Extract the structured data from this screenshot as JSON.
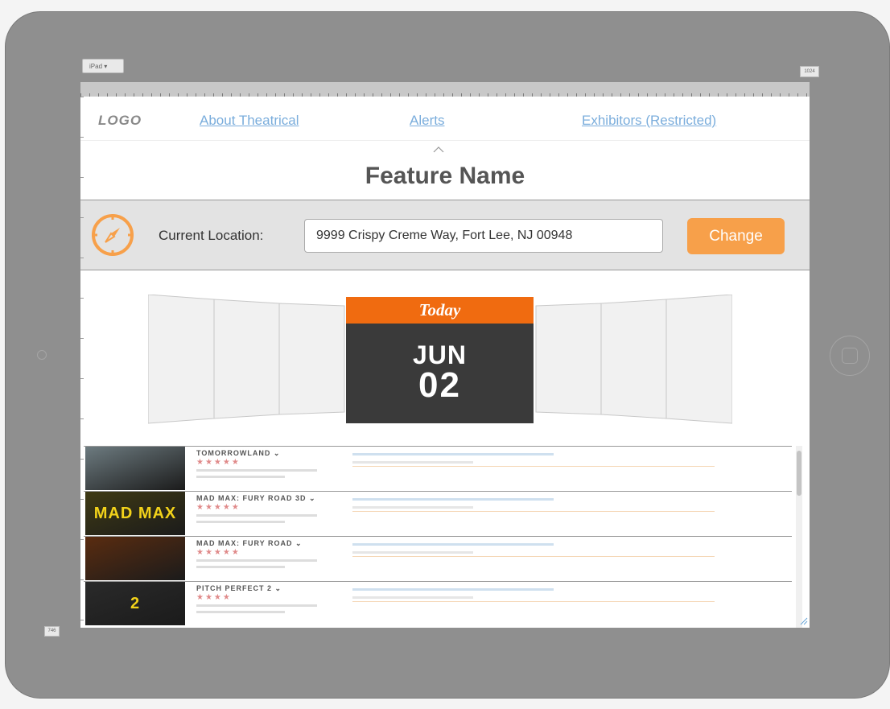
{
  "device": {
    "model_select": "iPad ▾",
    "width_tag": "1024",
    "height_tag": "746"
  },
  "nav": {
    "logo": "LOGO",
    "links": [
      "About Theatrical",
      "Alerts",
      "Exhibitors (Restricted)"
    ]
  },
  "feature": {
    "title": "Feature Name"
  },
  "location": {
    "label": "Current Location:",
    "value": "9999 Crispy Creme Way, Fort Lee, NJ 00948",
    "button": "Change"
  },
  "date_carousel": {
    "today_label": "Today",
    "month": "JUN",
    "day": "02"
  },
  "movies": [
    {
      "title": "TOMORROWLAND ⌄",
      "stars": "★★★★★",
      "poster_color": "#6d7b80"
    },
    {
      "title": "MAD MAX: FURY ROAD 3D ⌄",
      "stars": "★★★★★",
      "poster_color": "#3f3a14",
      "poster_text": "MAD MAX"
    },
    {
      "title": "MAD MAX: FURY ROAD ⌄",
      "stars": "★★★★★",
      "poster_color": "#5a2c10"
    },
    {
      "title": "PITCH PERFECT 2 ⌄",
      "stars": "★★★★",
      "poster_color": "#2a2a2a",
      "poster_text": "2"
    }
  ],
  "colors": {
    "accent_orange": "#f7a04a",
    "today_header": "#f06b10",
    "link_blue": "#7aaddc"
  }
}
